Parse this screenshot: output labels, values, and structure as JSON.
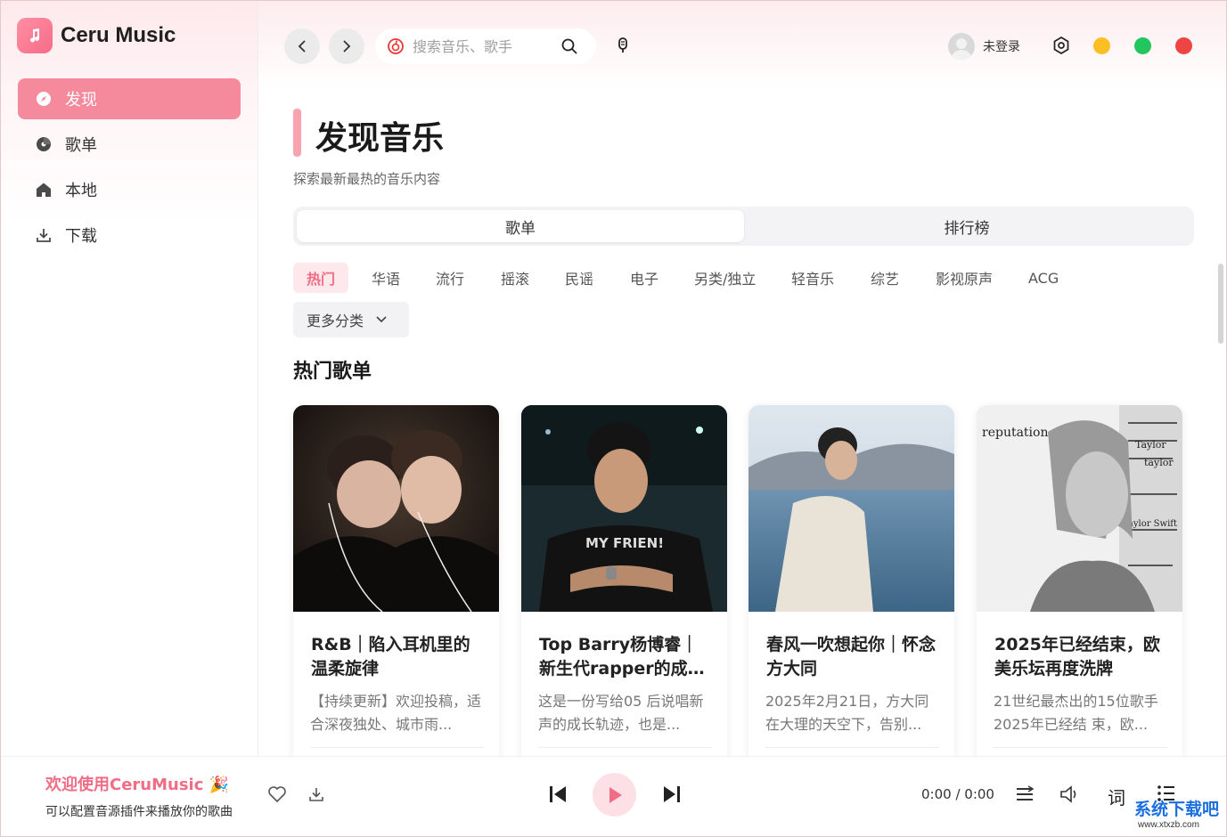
{
  "app": {
    "name": "Ceru Music"
  },
  "sidebar": {
    "items": [
      {
        "label": "发现",
        "icon": "compass-icon",
        "active": true
      },
      {
        "label": "歌单",
        "icon": "disc-icon",
        "active": false
      },
      {
        "label": "本地",
        "icon": "home-icon",
        "active": false
      },
      {
        "label": "下载",
        "icon": "download-icon",
        "active": false
      }
    ]
  },
  "topbar": {
    "search_placeholder": "搜索音乐、歌手",
    "user_label": "未登录",
    "window_colors": {
      "minimize": "#fbbf24",
      "maximize": "#22c55e",
      "close": "#ef4444"
    }
  },
  "page": {
    "title": "发现音乐",
    "subtitle": "探索最新最热的音乐内容",
    "tabs": [
      "歌单",
      "排行榜"
    ],
    "categories": [
      "热门",
      "华语",
      "流行",
      "摇滚",
      "民谣",
      "电子",
      "另类/独立",
      "轻音乐",
      "综艺",
      "影视原声",
      "ACG"
    ],
    "more_categories": "更多分类",
    "section_title": "热门歌单"
  },
  "playlists": [
    {
      "title": "R&B｜陷入耳机里的温柔旋律",
      "desc": "【持续更新】欢迎投稿，适合深夜独处、城市雨..."
    },
    {
      "title": "Top Barry杨博睿｜新生代rapper的成长...",
      "desc": "这是一份写给05 后说唱新声的成长轨迹，也是..."
    },
    {
      "title": "春风一吹想起你｜怀念方大同",
      "desc": "2025年2月21日，方大同在大理的天空下，告别..."
    },
    {
      "title": "2025年已经结束，欧美乐坛再度洗牌",
      "desc": "21世纪最杰出的15位歌手2025年已经结 束，欧..."
    }
  ],
  "cover_texts": {
    "shirt": "MY FRIEN!",
    "album": "reputation",
    "newsprint_1": "Taylor",
    "newsprint_2": "taylor",
    "newsprint_3": "Taylor Swift"
  },
  "player": {
    "welcome": "欢迎使用CeruMusic 🎉",
    "hint": "可以配置音源插件来播放你的歌曲",
    "time": "0:00 / 0:00",
    "lyrics_label": "词"
  },
  "watermark": {
    "name": "系统下载吧",
    "url": "www.xtxzb.com"
  },
  "colors": {
    "accent": "#f48a9c",
    "accent_text": "#f06d86"
  }
}
